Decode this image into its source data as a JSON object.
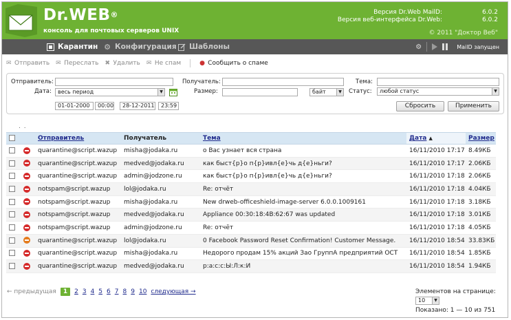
{
  "header": {
    "brand": "Dr.WEB",
    "brand_mark": "®",
    "subtitle": "консоль для почтовых серверов UNIX",
    "maild_version_label": "Версия Dr.Web MailD:",
    "maild_version": "6.0.2",
    "web_version_label": "Версия веб-интерфейса Dr.Web:",
    "web_version": "6.0.2",
    "copyright": "© 2011 \"Доктор Веб\""
  },
  "nav": {
    "items": [
      {
        "label": "Карантин",
        "icon": "quarantine-icon",
        "active": true
      },
      {
        "label": "Конфигурация",
        "icon": "gear-icon",
        "active": false
      },
      {
        "label": "Шаблоны",
        "icon": "edit-icon",
        "active": false
      }
    ],
    "status": "MailD запущен"
  },
  "toolbar": {
    "send": "Отправить",
    "forward": "Переслать",
    "delete": "Удалить",
    "not_spam": "Не спам",
    "report_spam": "Сообщить о спаме"
  },
  "filter": {
    "sender_label": "Отправитель:",
    "recipient_label": "Получатель:",
    "subject_label": "Тема:",
    "date_label": "Дата:",
    "date_value": "весь период",
    "size_label": "Размер:",
    "size_unit": "байт",
    "status_label": "Статус:",
    "status_value": "любой статус",
    "date_from": "01-01-2000",
    "time_from": "00:00",
    "date_to": "28-12-2011",
    "time_to": "23:59",
    "reset_label": "Сбросить",
    "apply_label": "Применить"
  },
  "table": {
    "headers": {
      "sender": "Отправитель",
      "recipient": "Получатель",
      "subject": "Тема",
      "date": "Дата",
      "date_sort": "▲",
      "size": "Размер"
    },
    "rows": [
      {
        "sender": "quarantine@script.wazup",
        "recipient": "misha@jodaka.ru",
        "subject": "о Вас узнает вся страна",
        "date": "16/11/2010 17:17",
        "size": "8.49КБ",
        "status_icon": "blocked-icon"
      },
      {
        "sender": "quarantine@script.wazup",
        "recipient": "medved@jodaka.ru",
        "subject": "как быст{р}о п{р}ивл{е}чь д{е}ньги?",
        "date": "16/11/2010 17:17",
        "size": "2.06КБ",
        "status_icon": "blocked-icon"
      },
      {
        "sender": "quarantine@script.wazup",
        "recipient": "admin@jodzone.ru",
        "subject": "как быст{р}о п{р}ивл{е}чь д{е}ньги?",
        "date": "16/11/2010 17:18",
        "size": "2.06КБ",
        "status_icon": "blocked-icon"
      },
      {
        "sender": "notspam@script.wazup",
        "recipient": "lol@jodaka.ru",
        "subject": "Re: отчёт",
        "date": "16/11/2010 17:18",
        "size": "4.04КБ",
        "status_icon": "blocked-icon"
      },
      {
        "sender": "notspam@script.wazup",
        "recipient": "misha@jodaka.ru",
        "subject": "New drweb-officeshield-image-server 6.0.0.1009161",
        "date": "16/11/2010 17:18",
        "size": "3.18КБ",
        "status_icon": "blocked-icon"
      },
      {
        "sender": "notspam@script.wazup",
        "recipient": "medved@jodaka.ru",
        "subject": "Appliance 00:30:18:4B:62:67 was updated",
        "date": "16/11/2010 17:18",
        "size": "3.01КБ",
        "status_icon": "blocked-icon"
      },
      {
        "sender": "notspam@script.wazup",
        "recipient": "admin@jodzone.ru",
        "subject": "Re: отчёт",
        "date": "16/11/2010 17:18",
        "size": "4.05КБ",
        "status_icon": "blocked-icon"
      },
      {
        "sender": "quarantine@script.wazup",
        "recipient": "lol@jodaka.ru",
        "subject": "0 Facebook Password Reset Confirmation! Customer Message.",
        "date": "16/11/2010 18:54",
        "size": "33.83КБ",
        "status_icon": "virus-icon"
      },
      {
        "sender": "quarantine@script.wazup",
        "recipient": "misha@jodaka.ru",
        "subject": "Недорого продам 15% акций Зао ГруппА предприятий ОСТ",
        "date": "16/11/2010 18:54",
        "size": "1.85КБ",
        "status_icon": "blocked-icon"
      },
      {
        "sender": "quarantine@script.wazup",
        "recipient": "medved@jodaka.ru",
        "subject": "р:а:с:с:Ы:Л:к:И",
        "date": "16/11/2010 18:54",
        "size": "1.94КБ",
        "status_icon": "blocked-icon"
      }
    ]
  },
  "pager": {
    "prev": "← предыдущая",
    "pages": [
      "1",
      "2",
      "3",
      "4",
      "5",
      "6",
      "7",
      "8",
      "9",
      "10"
    ],
    "current": "1",
    "next": "следующая →",
    "per_page_label": "Элементов на странице:",
    "per_page_value": "10",
    "shown": "Показано: 1 — 10 из 751"
  }
}
